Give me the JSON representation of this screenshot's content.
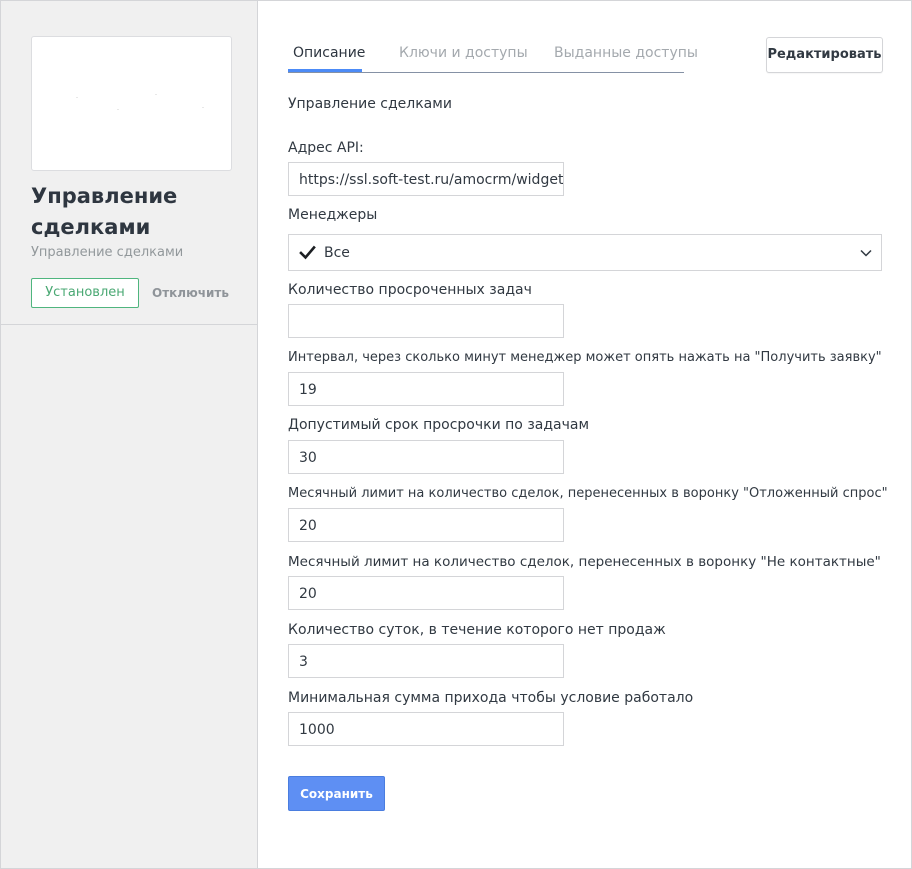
{
  "sidebar": {
    "title": "Управление сделками",
    "subtitle": "Управление сделками",
    "installed_label": "Установлен",
    "disable_label": "Отключить"
  },
  "tabs": [
    {
      "label": "Описание",
      "active": true
    },
    {
      "label": "Ключи и доступы",
      "active": false
    },
    {
      "label": "Выданные доступы",
      "active": false
    }
  ],
  "edit_label": "Редактировать",
  "description": "Управление сделками",
  "fields": {
    "api": {
      "label": "Адрес API:",
      "value": "https://ssl.soft-test.ru/amocrm/widget/"
    },
    "managers": {
      "label": "Менеджеры",
      "value": "Все",
      "checked": true
    },
    "overdue_count": {
      "label": "Количество просроченных задач",
      "value": ""
    },
    "interval": {
      "label": "Интервал, через сколько минут менеджер может опять нажать на \"Получить заявку\"",
      "value": "19"
    },
    "overdue_term": {
      "label": "Допустимый срок просрочки по задачам",
      "value": "30"
    },
    "limit_deferred": {
      "label": "Месячный лимит на количество сделок, перенесенных в воронку \"Отложенный спрос\"",
      "value": "20"
    },
    "limit_noncontact": {
      "label": "Месячный лимит на количество сделок, перенесенных в воронку \"Не контактные\"",
      "value": "20"
    },
    "no_sales_days": {
      "label": "Количество суток, в течение которого нет продаж",
      "value": "3"
    },
    "min_sum": {
      "label": "Минимальная сумма прихода чтобы условие работало",
      "value": "1000"
    }
  },
  "save_label": "Сохранить",
  "colors": {
    "accent": "#4c8bf7",
    "save_button": "#5e8ff3",
    "installed_green": "#4fb57e",
    "sidebar_bg": "#f0f0f0"
  }
}
